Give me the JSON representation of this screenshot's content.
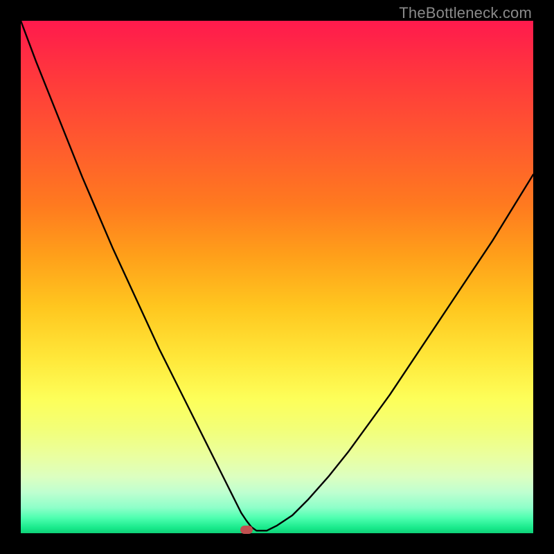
{
  "watermark": "TheBottleneck.com",
  "colors": {
    "frame": "#000000",
    "curve": "#000000",
    "marker": "#c05050"
  },
  "chart_data": {
    "type": "line",
    "title": "",
    "xlabel": "",
    "ylabel": "",
    "xlim": [
      0,
      100
    ],
    "ylim": [
      0,
      100
    ],
    "grid": false,
    "legend": false,
    "series": [
      {
        "name": "bottleneck-curve",
        "x": [
          0,
          3,
          6,
          9,
          12,
          15,
          18,
          21,
          24,
          27,
          30,
          33,
          36,
          38,
          40,
          41,
          42,
          43,
          44,
          45,
          46,
          48,
          50,
          53,
          56,
          60,
          64,
          68,
          72,
          76,
          80,
          84,
          88,
          92,
          96,
          100
        ],
        "y": [
          100,
          92,
          84.5,
          77,
          69.5,
          62.5,
          55.5,
          49,
          42.5,
          36,
          30,
          24,
          18,
          14,
          10,
          8,
          6,
          4,
          2.5,
          1.2,
          0.5,
          0.5,
          1.5,
          3.5,
          6.5,
          11,
          16,
          21.5,
          27,
          33,
          39,
          45,
          51,
          57,
          63.5,
          70
        ]
      }
    ],
    "marker": {
      "x": 44,
      "y": 0.7
    },
    "background_gradient": {
      "top": "#ff1a4d",
      "mid": "#ffe83a",
      "bottom": "#0fd077"
    }
  }
}
